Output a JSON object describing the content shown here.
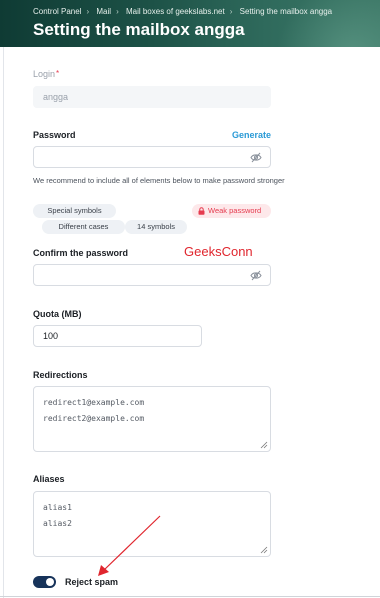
{
  "breadcrumb": [
    "Control Panel",
    "Mail",
    "Mail boxes of geekslabs.net",
    "Setting the mailbox angga"
  ],
  "title": "Setting the mailbox angga",
  "login": {
    "label": "Login",
    "required": "*",
    "value": "angga"
  },
  "password": {
    "label": "Password",
    "generate_label": "Generate",
    "value": "",
    "hint": "We recommend to include all of elements below to make password stronger",
    "requirements": [
      "Special symbols",
      "Different cases",
      "14 symbols"
    ],
    "strength": "Weak password"
  },
  "confirm": {
    "label": "Confirm the password",
    "value": ""
  },
  "watermark": "GeeksConn",
  "quota": {
    "label": "Quota (MB)",
    "value": "100"
  },
  "redirections": {
    "label": "Redirections",
    "lines": [
      "redirect1@example.com",
      "redirect2@example.com"
    ]
  },
  "aliases": {
    "label": "Aliases",
    "lines": [
      "alias1",
      "alias2"
    ]
  },
  "reject_spam": {
    "label": "Reject spam",
    "checked": true
  },
  "colors": {
    "accent": "#2a9ad6",
    "danger": "#e53b4f",
    "toggle": "#17335a",
    "header": "#1d5247"
  },
  "icons": {
    "eye": "eye-off-icon",
    "lock": "lock-icon",
    "chevron": "chevron-right-icon"
  }
}
